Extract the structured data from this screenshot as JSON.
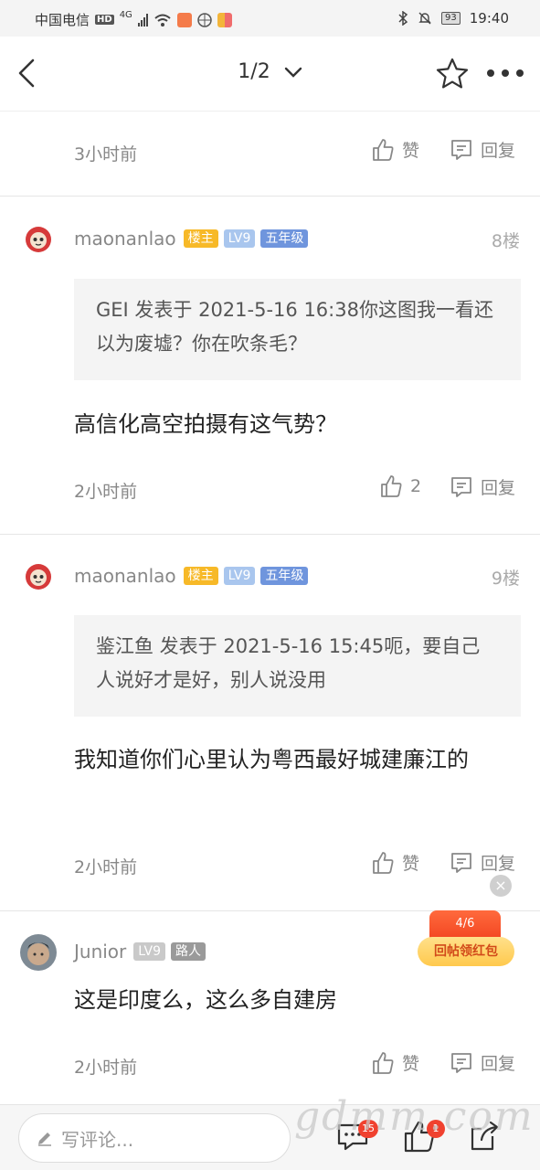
{
  "status_bar": {
    "carrier": "中国电信",
    "hd": "HD",
    "network": "4G",
    "battery": "93",
    "time": "19:40"
  },
  "nav": {
    "page_indicator": "1/2"
  },
  "posts": [
    {
      "time": "3小时前",
      "like_label": "赞",
      "reply_label": "回复"
    },
    {
      "username": "maonanlao",
      "tags": [
        "楼主",
        "LV9",
        "五年级"
      ],
      "floor": "8楼",
      "quote": "GEI 发表于 2021-5-16 16:38你这图我一看还以为废墟？你在吹条毛？",
      "content": "高信化高空拍摄有这气势？",
      "time": "2小时前",
      "like_label": "2",
      "reply_label": "回复"
    },
    {
      "username": "maonanlao",
      "tags": [
        "楼主",
        "LV9",
        "五年级"
      ],
      "floor": "9楼",
      "quote": "鉴江鱼 发表于 2021-5-16 15:45呃，要自己人说好才是好，别人说没用",
      "content": "我知道你们心里认为粤西最好城建廉江的",
      "time": "2小时前",
      "like_label": "赞",
      "reply_label": "回复"
    },
    {
      "username": "Junior",
      "tags": [
        "LV9",
        "路人"
      ],
      "content": "这是印度么，这么多自建房",
      "time": "2小时前",
      "like_label": "赞",
      "reply_label": "回复"
    }
  ],
  "red_packet": {
    "progress": "4/6",
    "button": "回帖领红包",
    "close": "×"
  },
  "bottom_bar": {
    "comment_placeholder": "写评论...",
    "comment_badge": "15",
    "like_badge": "1"
  },
  "watermark": "gdmm.com",
  "colors": {
    "owner_tag": "#f7b928",
    "level_tag": "#a9c6ee",
    "grade_tag": "#6f95dd",
    "badge_red": "#f0412f"
  }
}
